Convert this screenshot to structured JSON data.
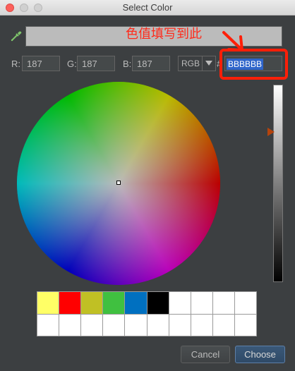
{
  "window": {
    "title": "Select Color"
  },
  "icons": {
    "picker": "eyedropper-icon",
    "mode_dropdown": "chevron-down-icon"
  },
  "preview": {
    "color": "#BBBBBB"
  },
  "annotation": {
    "text": "色值填写到此",
    "color": "#ff2a1a"
  },
  "fields": {
    "r_label": "R:",
    "r_value": "187",
    "g_label": "G:",
    "g_value": "187",
    "b_label": "B:",
    "b_value": "187"
  },
  "mode": {
    "selected": "RGB"
  },
  "hex": {
    "prefix": "#",
    "value": "BBBBBB"
  },
  "brightness": {
    "level": 0.76
  },
  "recent_colors": [
    "#ffff66",
    "#ff0000",
    "#c0c024",
    "#40c040",
    "#0070c0",
    "#000000",
    "#ffffff",
    "#ffffff",
    "#ffffff",
    "#ffffff",
    "#ffffff",
    "#ffffff",
    "#ffffff",
    "#ffffff",
    "#ffffff",
    "#ffffff",
    "#ffffff",
    "#ffffff",
    "#ffffff",
    "#ffffff"
  ],
  "buttons": {
    "cancel": "Cancel",
    "choose": "Choose"
  }
}
